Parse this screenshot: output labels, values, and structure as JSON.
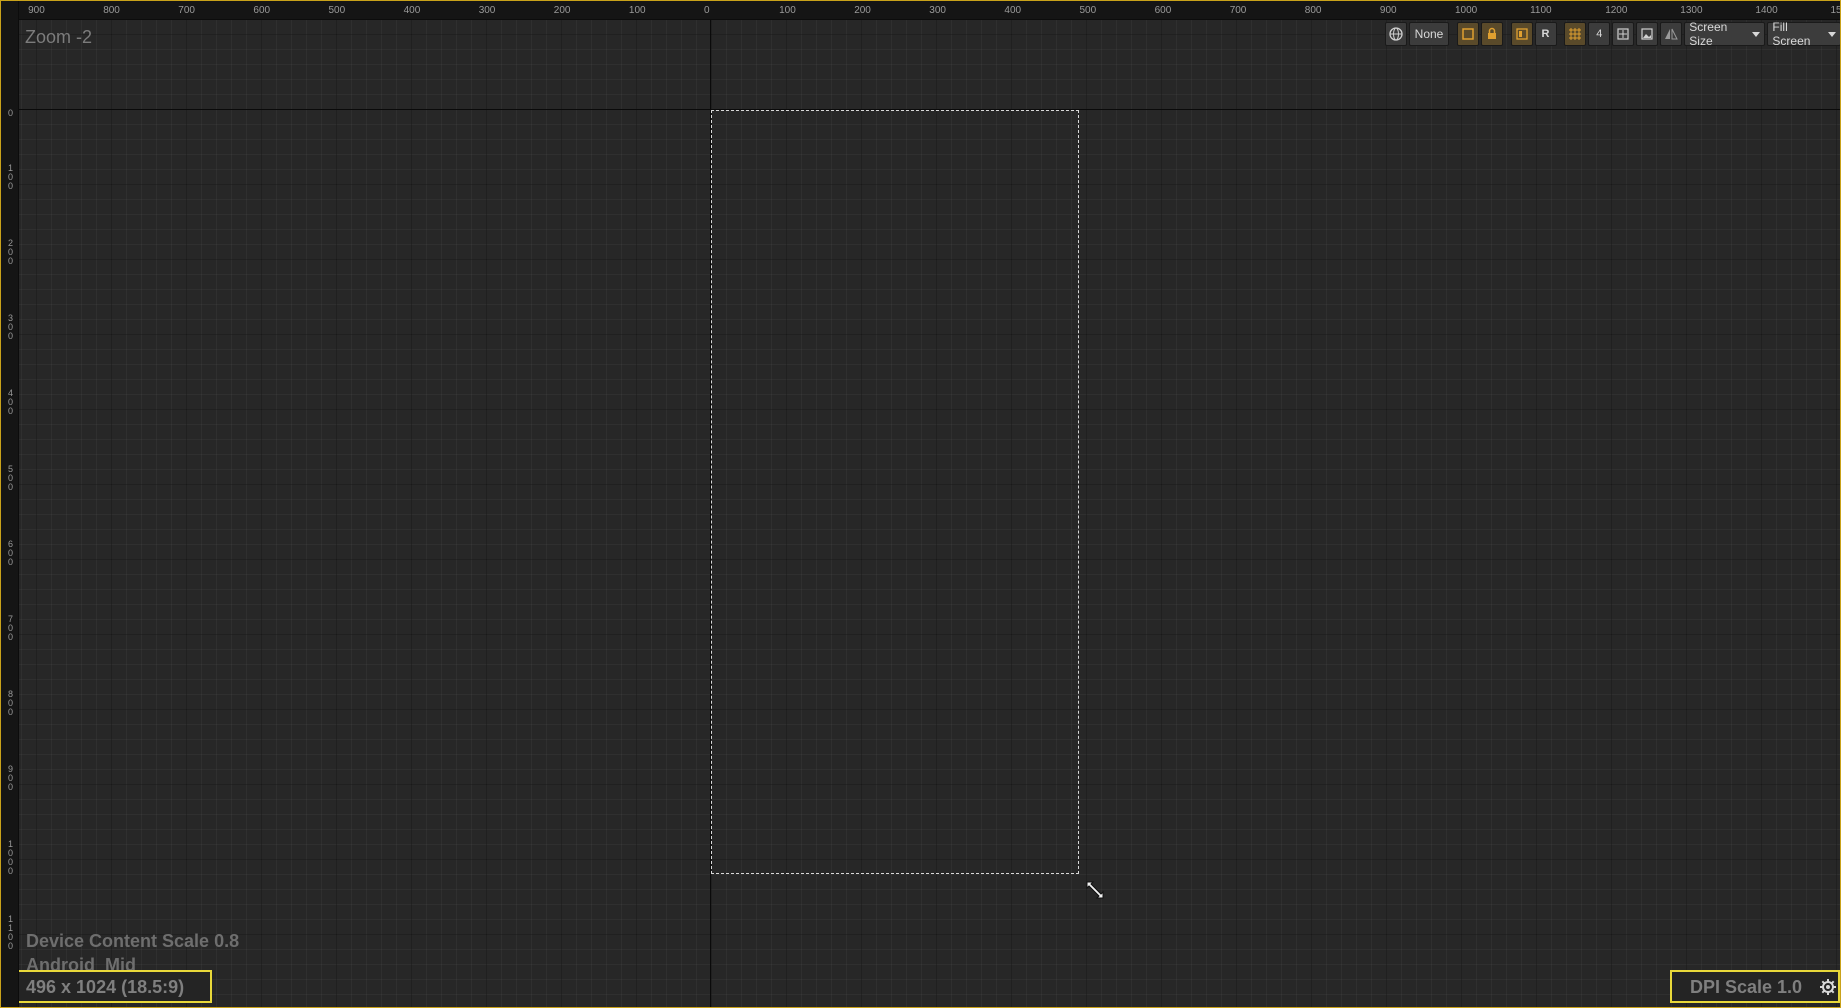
{
  "top_ruler": {
    "labels": [
      "900",
      "800",
      "700",
      "600",
      "500",
      "400",
      "300",
      "200",
      "100",
      "0",
      "100",
      "200",
      "300",
      "400",
      "500",
      "600",
      "700",
      "800",
      "900",
      "1000",
      "1100",
      "1200",
      "1300",
      "1400",
      "15"
    ]
  },
  "left_ruler": {
    "labels": [
      "0",
      "100",
      "200",
      "300",
      "400",
      "500",
      "600",
      "700",
      "800",
      "900",
      "1000",
      "1100"
    ]
  },
  "canvas": {
    "zoom_label": "Zoom -2",
    "device_scale": "Device Content Scale 0.8",
    "device_name": "Android_Mid",
    "resolution": "496 x 1024 (18.5:9)",
    "dpi_scale": "DPI Scale 1.0"
  },
  "toolbar": {
    "globe_icon": "globe-icon",
    "localization_value": "None",
    "snap_label": "R",
    "grid_snap_value": "4",
    "screen_size_label": "Screen Size",
    "fill_screen_label": "Fill Screen"
  },
  "colors": {
    "accent": "#e8d83a",
    "border": "#c9a21a",
    "background": "#262626"
  }
}
